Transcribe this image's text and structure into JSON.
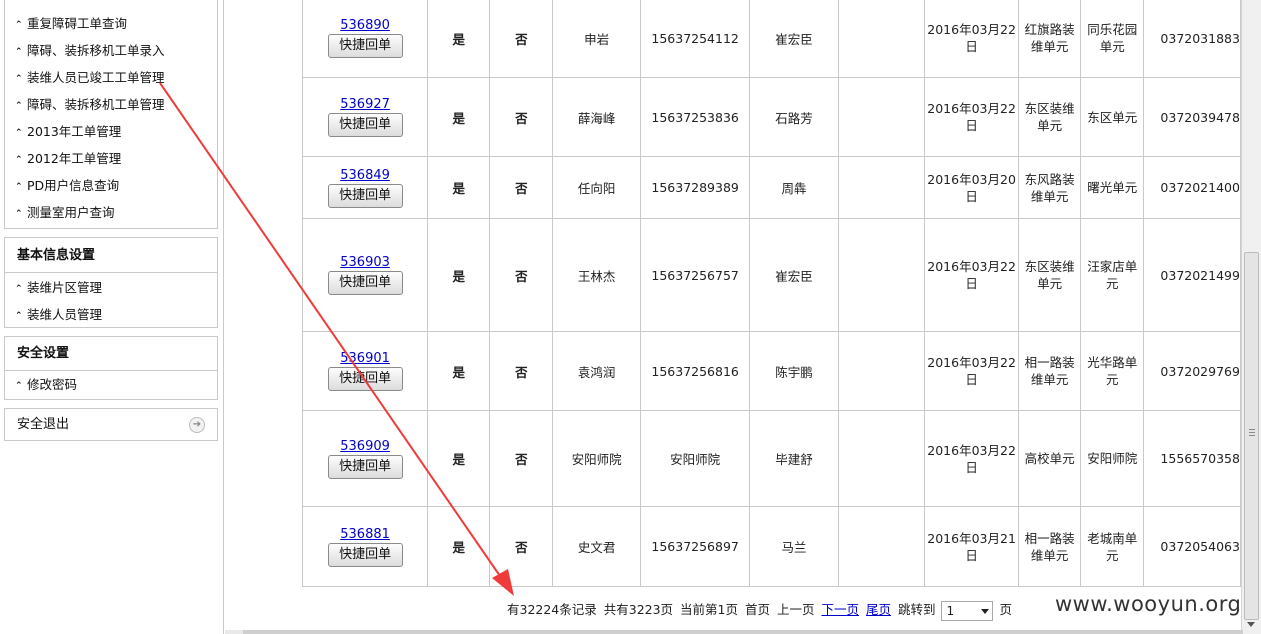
{
  "sidebar": {
    "panel1": {
      "items": [
        {
          "label": "重复障碍工单查询"
        },
        {
          "label": "障碍、装拆移机工单录入"
        },
        {
          "label": "装维人员已竣工工单管理"
        },
        {
          "label": "障碍、装拆移机工单管理"
        },
        {
          "label": "2013年工单管理"
        },
        {
          "label": "2012年工单管理"
        },
        {
          "label": "PD用户信息查询"
        },
        {
          "label": "测量室用户查询"
        }
      ]
    },
    "panel2": {
      "title": "基本信息设置",
      "items": [
        {
          "label": "装维片区管理"
        },
        {
          "label": "装维人员管理"
        }
      ]
    },
    "panel3": {
      "title": "安全设置",
      "items": [
        {
          "label": "修改密码"
        }
      ]
    },
    "logout_label": "安全退出",
    "chevron_glyph": "⌃",
    "logout_icon": "arrow-right-circle-icon"
  },
  "table": {
    "button_label": "快捷回单",
    "rows": [
      {
        "id": "536890",
        "flag1": "是",
        "flag2": "否",
        "name": "申岩",
        "phone": "15637254112",
        "staff": "崔宏臣",
        "extra": "",
        "date": "2016年03月22日",
        "unit": "红旗路装维单元",
        "area": "同乐花园单元",
        "phone2": "0372031883"
      },
      {
        "id": "536927",
        "flag1": "是",
        "flag2": "否",
        "name": "薛海峰",
        "phone": "15637253836",
        "staff": "石路芳",
        "extra": "",
        "date": "2016年03月22日",
        "unit": "东区装维单元",
        "area": "东区单元",
        "phone2": "0372039478"
      },
      {
        "id": "536849",
        "flag1": "是",
        "flag2": "否",
        "name": "任向阳",
        "phone": "15637289389",
        "staff": "周犇",
        "extra": "",
        "date": "2016年03月20日",
        "unit": "东风路装维单元",
        "area": "曙光单元",
        "phone2": "0372021400"
      },
      {
        "id": "536903",
        "flag1": "是",
        "flag2": "否",
        "name": "王林杰",
        "phone": "15637256757",
        "staff": "崔宏臣",
        "extra": "",
        "date": "2016年03月22日",
        "unit": "东区装维单元",
        "area": "汪家店单元",
        "phone2": "0372021499"
      },
      {
        "id": "536901",
        "flag1": "是",
        "flag2": "否",
        "name": "袁鸿润",
        "phone": "15637256816",
        "staff": "陈宇鹏",
        "extra": "",
        "date": "2016年03月22日",
        "unit": "相一路装维单元",
        "area": "光华路单元",
        "phone2": "0372029769"
      },
      {
        "id": "536909",
        "flag1": "是",
        "flag2": "否",
        "name": "安阳师院",
        "phone": "安阳师院",
        "staff": "毕建舒",
        "extra": "",
        "date": "2016年03月22日",
        "unit": "高校单元",
        "area": "安阳师院",
        "phone2": "1556570358"
      },
      {
        "id": "536881",
        "flag1": "是",
        "flag2": "否",
        "name": "史文君",
        "phone": "15637256897",
        "staff": "马兰",
        "extra": "",
        "date": "2016年03月21日",
        "unit": "相一路装维单元",
        "area": "老城南单元",
        "phone2": "0372054063"
      }
    ]
  },
  "pager": {
    "records": "有32224条记录",
    "pages": "共有3223页",
    "current": "当前第1页",
    "first": "首页",
    "prev": "上一页",
    "next": "下一页",
    "last": "尾页",
    "jump_label": "跳转到",
    "jump_value": "1",
    "page_unit": "页"
  },
  "watermark": "www.wooyun.org",
  "colors": {
    "accent_red": "#e40000",
    "link_blue": "#0000cc",
    "annotation_arrow": "#ef3b3b"
  }
}
